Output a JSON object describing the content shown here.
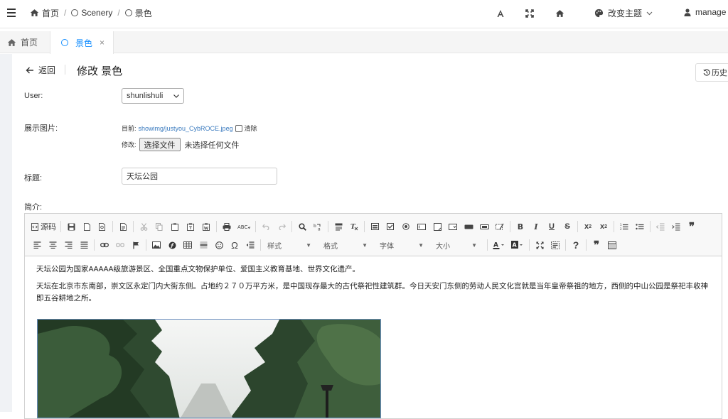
{
  "breadcrumb": {
    "home": "首页",
    "mid": "Scenery",
    "current": "景色"
  },
  "topbar": {
    "theme_label": "改变主题",
    "user_label": "manage"
  },
  "tabs": [
    {
      "label": "首页"
    },
    {
      "label": "景色",
      "close": "×"
    }
  ],
  "page": {
    "back_label": "返回",
    "title": "修改 景色",
    "history_label": "历史"
  },
  "form": {
    "user_label": "User:",
    "user_value": "shunlishuli",
    "image_label": "展示图片:",
    "current_prefix": "目前:",
    "current_file": "showimg/justyou_CybROCE.jpeg",
    "clear_label": "清除",
    "modify_prefix": "修改:",
    "file_button": "选择文件",
    "file_none": "未选择任何文件",
    "title_label": "标题:",
    "title_value": "天坛公园",
    "intro_label": "简介:"
  },
  "editor": {
    "source_label": "源码",
    "combo_style": "样式",
    "combo_format": "格式",
    "combo_font": "字体",
    "combo_size": "大小",
    "para1": "天坛公园为国家AAAAA级旅游景区、全国重点文物保护单位、爱国主义教育基地、世界文化遗产。",
    "para2": "天坛在北京市东南部，崇文区永定门内大街东侧。占地约２７０万平方米，是中国现存最大的古代祭祀性建筑群。今日天安门东侧的劳动人民文化宫就是当年皇帝祭祖的地方，西侧的中山公园是祭祀丰收神即五谷耕地之所。"
  },
  "colors": {
    "accent": "#1890ff",
    "link": "#3b7bbf"
  }
}
